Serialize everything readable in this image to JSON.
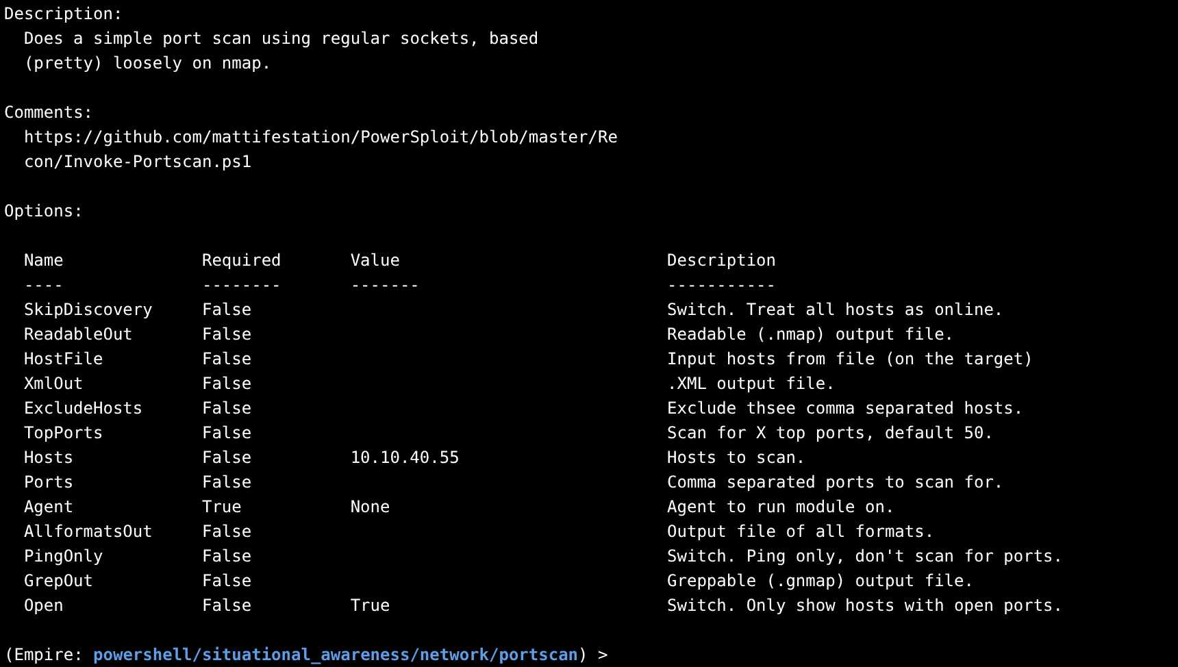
{
  "sections": [
    {
      "heading": "Description:",
      "lines": [
        "Does a simple port scan using regular sockets, based",
        "(pretty) loosely on nmap."
      ]
    },
    {
      "heading": "Comments:",
      "lines": [
        "https://github.com/mattifestation/PowerSploit/blob/master/Re",
        "con/Invoke-Portscan.ps1"
      ]
    },
    {
      "heading": "Options:"
    }
  ],
  "options_table": {
    "columns": [
      "Name",
      "Required",
      "Value",
      "Description"
    ],
    "underlines": [
      "----",
      "--------",
      "-------",
      "-----------"
    ],
    "rows": [
      [
        "SkipDiscovery",
        "False",
        "",
        "Switch. Treat all hosts as online."
      ],
      [
        "ReadableOut",
        "False",
        "",
        "Readable (.nmap) output file."
      ],
      [
        "HostFile",
        "False",
        "",
        "Input hosts from file (on the target)"
      ],
      [
        "XmlOut",
        "False",
        "",
        ".XML output file."
      ],
      [
        "ExcludeHosts",
        "False",
        "",
        "Exclude thsee comma separated hosts."
      ],
      [
        "TopPorts",
        "False",
        "",
        "Scan for X top ports, default 50."
      ],
      [
        "Hosts",
        "False",
        "10.10.40.55",
        "Hosts to scan."
      ],
      [
        "Ports",
        "False",
        "",
        "Comma separated ports to scan for."
      ],
      [
        "Agent",
        "True",
        "None",
        "Agent to run module on."
      ],
      [
        "AllformatsOut",
        "False",
        "",
        "Output file of all formats."
      ],
      [
        "PingOnly",
        "False",
        "",
        "Switch. Ping only, don't scan for ports."
      ],
      [
        "GrepOut",
        "False",
        "",
        "Greppable (.gnmap) output file."
      ],
      [
        "Open",
        "False",
        "True",
        "Switch. Only show hosts with open ports."
      ]
    ]
  },
  "prompt": {
    "prefix": "(Empire:",
    "module": "powershell/situational_awareness/network/portscan",
    "suffix": ") >"
  }
}
